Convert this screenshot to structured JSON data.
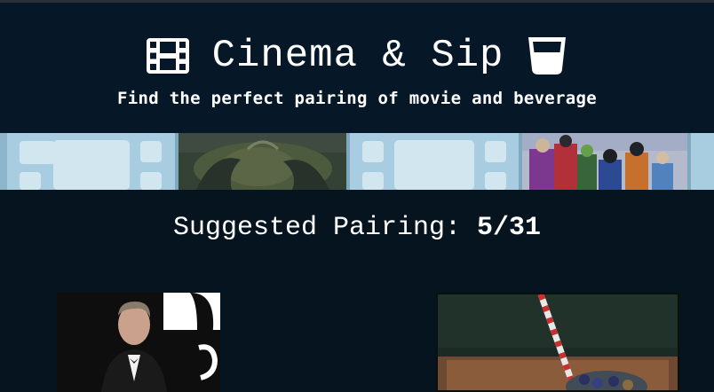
{
  "header": {
    "title": "Cinema & Sip",
    "subtitle": "Find the perfect pairing of movie and beverage",
    "left_icon": "film-icon",
    "right_icon": "glass-icon"
  },
  "filmstrip": {
    "frames": [
      "film-frame-placeholder",
      "movie-still-1",
      "film-frame-placeholder",
      "movie-still-2"
    ]
  },
  "pairing": {
    "label": "Suggested Pairing:",
    "count": "5/31"
  },
  "colors": {
    "background": "#06141f",
    "header": "#061828",
    "filmstrip": "#a9cde0"
  }
}
